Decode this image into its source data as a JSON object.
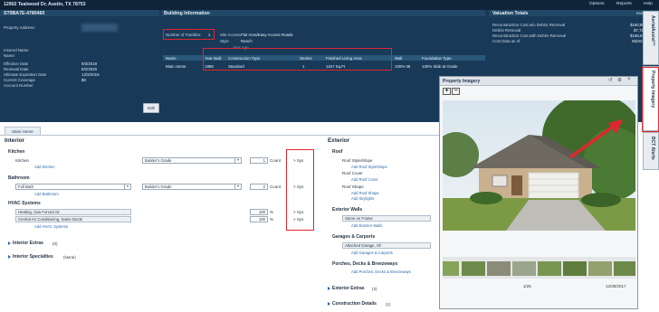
{
  "topbar": {
    "address": "12902 Tealwood Dr, Austin, TX 78753",
    "options": "Options",
    "reports": "Reports",
    "help": "Help"
  },
  "policy": {
    "id": "ST9BA7E-4780460",
    "labels": [
      "Property Address:",
      "Insured Name",
      "Name:",
      "Effective Date",
      "Renewal Date",
      "Ultimate Expiration Date",
      "Current Coverage",
      "Account Number"
    ],
    "values": [
      "",
      "",
      "",
      "9/3/2019",
      "9/2/2020",
      "12/2/2019",
      "$0",
      ""
    ],
    "edit": "Edit"
  },
  "building": {
    "title": "Building Information",
    "families_label": "Number of Families:",
    "families_value": "1",
    "site_access_label": "Site Access",
    "site_access_value": "Flat Area/Easy Access Roads",
    "style_label": "Style",
    "style_value": "Ranch",
    "year_age": "Year Age",
    "columns": [
      "Name",
      "Year Built",
      "Construction Type",
      "Stories",
      "Finished Living Area",
      "Wall",
      "Foundation Type"
    ],
    "row": [
      "Main Home",
      "1988",
      "Standard",
      "1",
      "1157 Sq.Ft",
      "100% 08",
      "100% Slab at Grade"
    ]
  },
  "valuation": {
    "title": "Valuation Totals",
    "more": "More Info",
    "labels": [
      "Reconstruction Cost w/o Debris Removal",
      "Debris Removal",
      "Reconstruction Cost with Debris Removal",
      "Cost Data as of"
    ],
    "values": [
      "$160,895",
      "$7,721",
      "$168,616",
      "05/2019"
    ]
  },
  "tabs": {
    "main_home": "Main Home"
  },
  "interior": {
    "title": "Interior",
    "kitchen": {
      "heading": "Kitchen",
      "label": "Kitchen",
      "grade": "Builder's Grade",
      "count": "1",
      "count_unit": "Count",
      "sys": "Sys",
      "add": "Add Kitchen"
    },
    "bathroom": {
      "heading": "Bathroom",
      "select": "Full Bath",
      "grade": "Builder's Grade",
      "count": "2",
      "count_unit": "Count",
      "sys": "Sys",
      "add": "Add Bathroom"
    },
    "hvac": {
      "heading": "HVAC Systems",
      "item1": "Heating, Gas Forced Air",
      "pct1": "100",
      "unit": "%",
      "sys": "Sys",
      "item2": "Central Air Conditioning, Same Ducts",
      "pct2": "100",
      "add": "Add HVAC Systems"
    },
    "extras": "Interior Extras",
    "extras_count": "(0)",
    "specialties": "Interior Specialties",
    "specialties_count": "(None)"
  },
  "exterior": {
    "title": "Exterior",
    "roof": "Roof",
    "roof_style": "Roof Style/Slope",
    "add_roof_style": "Add Roof Style/Slope",
    "roof_cover": "Roof Cover",
    "add_roof_cover": "Add Roof Cover",
    "roof_shape": "Roof Shape",
    "add_roof_shape": "Add Roof Shape",
    "add_skylights": "Add Skylights",
    "walls": "Exterior Walls",
    "walls_value": "Stone on Frame",
    "add_walls": "Add Exterior Walls",
    "garages": "Garages & Carports",
    "garage_value": "Attached Garage, SF",
    "add_garages": "Add Garages & Carports",
    "porches": "Porches, Decks & Breezeways",
    "add_porches": "Add Porches, Decks & Breezeways",
    "ext_extras": "Exterior Extras",
    "ext_extras_count": "(2)",
    "construction": "Construction Details",
    "construction_count": "(1)"
  },
  "imagery": {
    "title": "Property Imagery",
    "counter": "1/25",
    "date": "12/30/2017"
  },
  "sidetabs": {
    "aerial": "AerialAssist™",
    "property": "Property Imagery",
    "bct": "BCT Alerts"
  },
  "colors": {
    "header_bg": "#183958",
    "topbar_bg": "#0f2439",
    "highlight": "#e0262e",
    "link": "#2b68ad"
  }
}
